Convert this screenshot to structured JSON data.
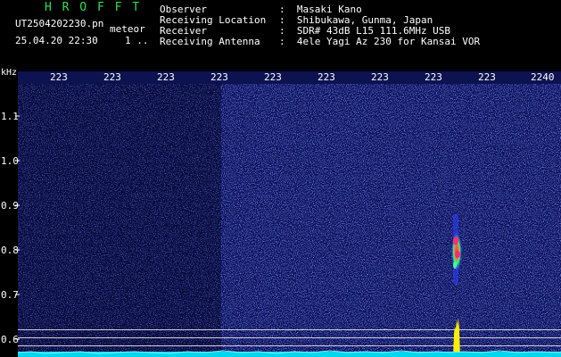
{
  "header": {
    "brand": "H R O F F T",
    "filename": "UT2504202230.pn",
    "tag": "meteor",
    "datetime": "25.04.20 22:30",
    "extra": "1 .."
  },
  "info": [
    {
      "label": "Observer",
      "value": ":  Masaki Kano"
    },
    {
      "label": "Receiving Location",
      "value": ":  Shibukawa, Gunma, Japan"
    },
    {
      "label": "Receiver",
      "value": ":  SDR# 43dB L15 111.6MHz USB"
    },
    {
      "label": "Receiving Antenna",
      "value": ":  4ele Yagi Az 230 for Kansai VOR"
    }
  ],
  "x_axis": {
    "ticks": [
      "223",
      "223",
      "223",
      "223",
      "223",
      "223",
      "223",
      "223",
      "223",
      "2240"
    ]
  },
  "y_axis": {
    "unit": "kHz",
    "ticks": [
      "1.1",
      "1.0",
      "0.9",
      "0.8",
      "0.7",
      "0.6"
    ]
  },
  "colors": {
    "brand": "#2ee04a",
    "noise": "#2233cc",
    "floor": "#00e5ff",
    "signal": "#ffee00",
    "echo": "#ff2a6a"
  }
}
